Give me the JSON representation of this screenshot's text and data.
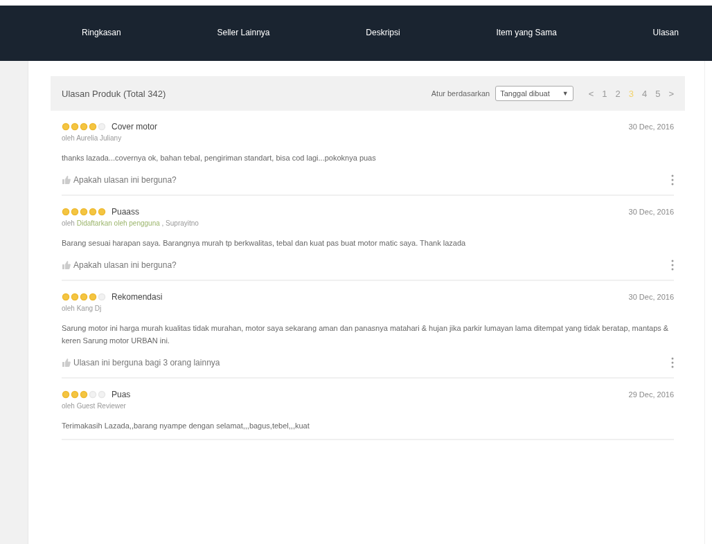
{
  "nav": {
    "tabs": [
      {
        "label": "Ringkasan"
      },
      {
        "label": "Seller Lainnya"
      },
      {
        "label": "Deskripsi"
      },
      {
        "label": "Item yang Sama"
      },
      {
        "label": "Ulasan"
      }
    ]
  },
  "reviews_panel": {
    "title": "Ulasan Produk (Total 342)",
    "sort_label": "Atur berdasarkan",
    "sort_value": "Tanggal dibuat",
    "sort_caret": "▼",
    "pagination": {
      "prev": "<",
      "next": ">",
      "pages": [
        {
          "label": "1",
          "selected": false
        },
        {
          "label": "2",
          "selected": false
        },
        {
          "label": "3",
          "selected": true
        },
        {
          "label": "4",
          "selected": false
        },
        {
          "label": "5",
          "selected": false
        }
      ]
    }
  },
  "reviews": [
    {
      "stars": 4,
      "title": "Cover motor",
      "date": "30 Dec, 2016",
      "byline": [
        {
          "kind": "text",
          "text": "oleh Aurelia Juliany"
        }
      ],
      "body": "thanks lazada...covernya ok, bahan tebal, pengiriman standart, bisa cod lagi...pokoknya puas",
      "helpful": "Apakah ulasan ini berguna?"
    },
    {
      "stars": 5,
      "title": "Puaass",
      "date": "30 Dec, 2016",
      "byline": [
        {
          "kind": "text",
          "text": "oleh"
        },
        {
          "kind": "badge",
          "text": "Didaftarkan oleh pengguna"
        },
        {
          "kind": "text",
          "text": ", Suprayitno"
        }
      ],
      "body": "Barang sesuai harapan saya. Barangnya murah tp berkwalitas, tebal dan kuat pas buat motor matic saya. Thank lazada",
      "helpful": "Apakah ulasan ini berguna?"
    },
    {
      "stars": 4,
      "title": "Rekomendasi",
      "date": "30 Dec, 2016",
      "byline": [
        {
          "kind": "text",
          "text": "oleh Kang Dj"
        }
      ],
      "body": "Sarung motor ini harga murah kualitas tidak murahan, motor saya sekarang aman dan panasnya matahari & hujan jika parkir lumayan lama ditempat yang tidak beratap, mantaps & keren Sarung motor URBAN ini.",
      "helpful": "Ulasan ini berguna bagi 3 orang lainnya"
    },
    {
      "stars": 3,
      "title": "Puas",
      "date": "29 Dec, 2016",
      "byline": [
        {
          "kind": "text",
          "text": "oleh Guest Reviewer"
        }
      ],
      "body": "Terimakasih Lazada,,barang nyampe dengan selamat,,,bagus,tebel,,,kuat"
    }
  ]
}
